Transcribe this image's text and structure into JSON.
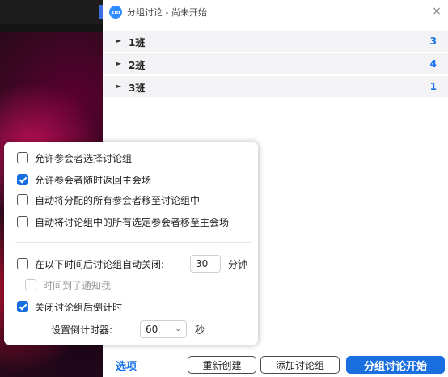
{
  "window": {
    "logo_text": "zm",
    "title": "分组讨论 - 尚未开始",
    "close_icon": "×"
  },
  "rooms": [
    {
      "name": "1班",
      "count": "3"
    },
    {
      "name": "2班",
      "count": "4"
    },
    {
      "name": "3班",
      "count": "1"
    }
  ],
  "options": {
    "allow_choose": {
      "label": "允许参会者选择讨论组",
      "checked": false
    },
    "allow_return": {
      "label": "允许参会者随时返回主会场",
      "checked": true
    },
    "auto_move": {
      "label": "自动将分配的所有参会者移至讨论组中",
      "checked": false
    },
    "auto_move_back": {
      "label": "自动将讨论组中的所有选定参会者移至主会场",
      "checked": false
    },
    "auto_close": {
      "label": "在以下时间后讨论组自动关闭:",
      "checked": false,
      "value": "30",
      "unit": "分钟"
    },
    "notify": {
      "label": "时间到了通知我",
      "checked": false,
      "disabled": true
    },
    "countdown": {
      "label": "关闭讨论组后倒计时",
      "checked": true
    },
    "timer": {
      "label": "设置倒计时器:",
      "value": "60",
      "unit": "秒"
    }
  },
  "footer": {
    "options_link": "选项",
    "recreate": "重新创建",
    "add_room": "添加讨论组",
    "start": "分组讨论开始"
  },
  "colors": {
    "accent": "#1a73e8",
    "primary_button": "#1a6fe0",
    "room_row_bg": "#f3f3f6"
  }
}
